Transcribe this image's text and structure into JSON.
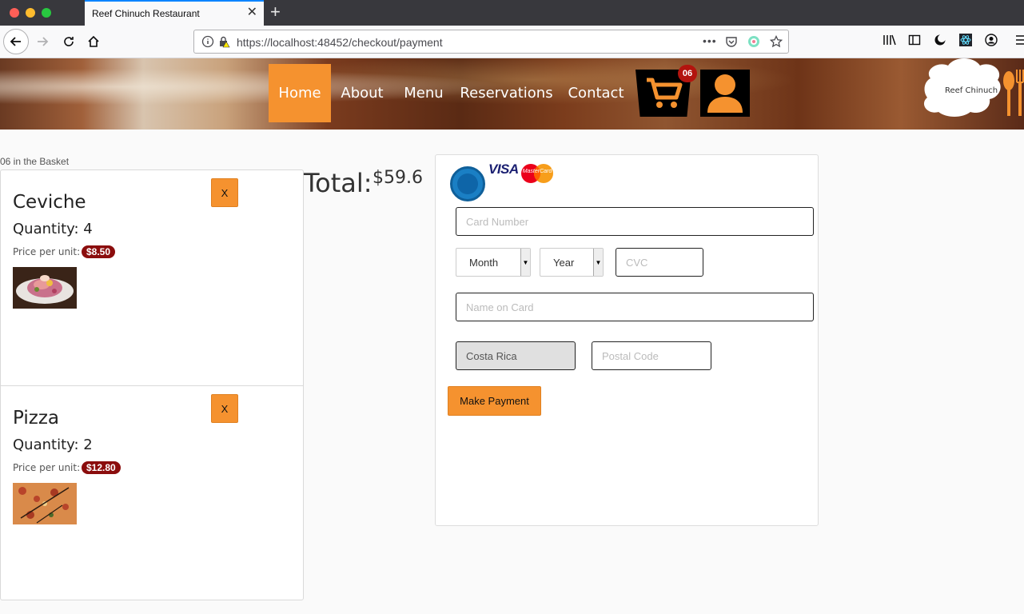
{
  "browser": {
    "tab_title": "Reef Chinuch Restaurant",
    "url": "https://localhost:48452/checkout/payment"
  },
  "nav": {
    "items": [
      "Home",
      "About",
      "Menu",
      "Reservations",
      "Contact"
    ],
    "active": "Home",
    "cart_count": "06"
  },
  "logo": {
    "text": "Reef Chinuch"
  },
  "basket": {
    "count_label": "06 in the Basket",
    "items": [
      {
        "name": "Ceviche",
        "quantity_label": "Quantity: 4",
        "price_label": "Price per unit:",
        "price": "$8.50",
        "remove_label": "X"
      },
      {
        "name": "Pizza",
        "quantity_label": "Quantity: 2",
        "price_label": "Price per unit:",
        "price": "$12.80",
        "remove_label": "X"
      }
    ]
  },
  "total": {
    "label": "Total:",
    "value": "$59.6"
  },
  "payment": {
    "visa_label": "VISA",
    "mastercard_label": "MasterCard",
    "card_number_placeholder": "Card Number",
    "month_label": "Month",
    "year_label": "Year",
    "cvc_placeholder": "CVC",
    "name_placeholder": "Name on Card",
    "country": "Costa Rica",
    "postal_placeholder": "Postal Code",
    "submit_label": "Make Payment"
  },
  "colors": {
    "accent": "#f5922f",
    "badge": "#8b0d0d",
    "cart_badge": "#b3140e",
    "radio": "#1a7fc4"
  }
}
